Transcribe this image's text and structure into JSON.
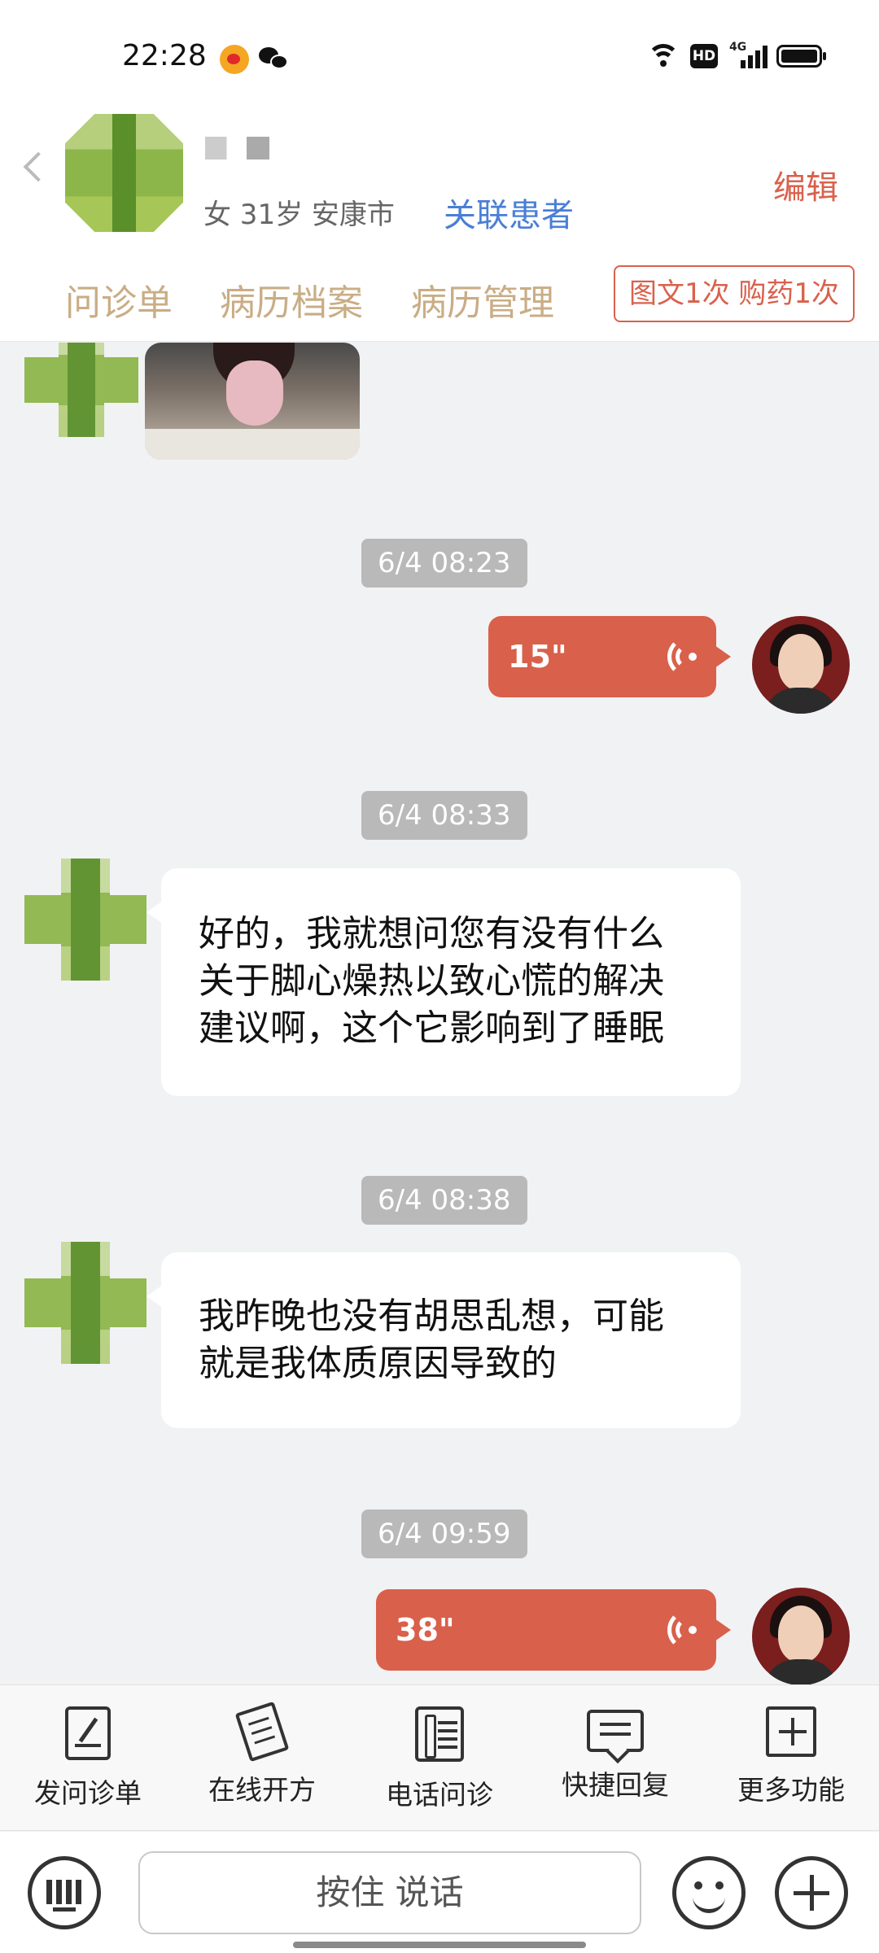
{
  "status_bar": {
    "time": "22:28",
    "notification_icons": [
      "weibo-icon",
      "wechat-icon"
    ],
    "system_icons": [
      "wifi-icon",
      "hd-icon",
      "signal-4g-icon",
      "battery-icon"
    ],
    "hd_label": "HD",
    "network_label": "4G"
  },
  "patient": {
    "info": "女 31岁  安康市",
    "link_label": "关联患者",
    "edit_label": "编辑"
  },
  "tabs": [
    {
      "label": "问诊单"
    },
    {
      "label": "病历档案"
    },
    {
      "label": "病历管理"
    }
  ],
  "service_badge": "图文1次 购药1次",
  "messages": {
    "t1": "6/4 08:23",
    "v1": "15\"",
    "t2": "6/4 08:33",
    "m1": [
      "好的，我就想问您有没有什么",
      "关于脚心燥热以致心慌的解决",
      "建议啊，这个它影响到了睡眠"
    ],
    "t3": "6/4 08:38",
    "m2": [
      "我昨晚也没有胡思乱想，可能",
      "就是我体质原因导致的"
    ],
    "t4": "6/4 09:59",
    "v2": "38\""
  },
  "tools": [
    {
      "label": "发问诊单",
      "icon": "form-icon"
    },
    {
      "label": "在线开方",
      "icon": "prescription-icon"
    },
    {
      "label": "电话问诊",
      "icon": "phone-icon"
    },
    {
      "label": "快捷回复",
      "icon": "quick-reply-icon"
    },
    {
      "label": "更多功能",
      "icon": "more-icon"
    }
  ],
  "input_bar": {
    "hold_to_talk": "按住 说话"
  },
  "colors": {
    "accent": "#d9604b",
    "link": "#4a7fd6",
    "tab_text": "#c9ad85",
    "chat_background": "#f1f2f4"
  }
}
